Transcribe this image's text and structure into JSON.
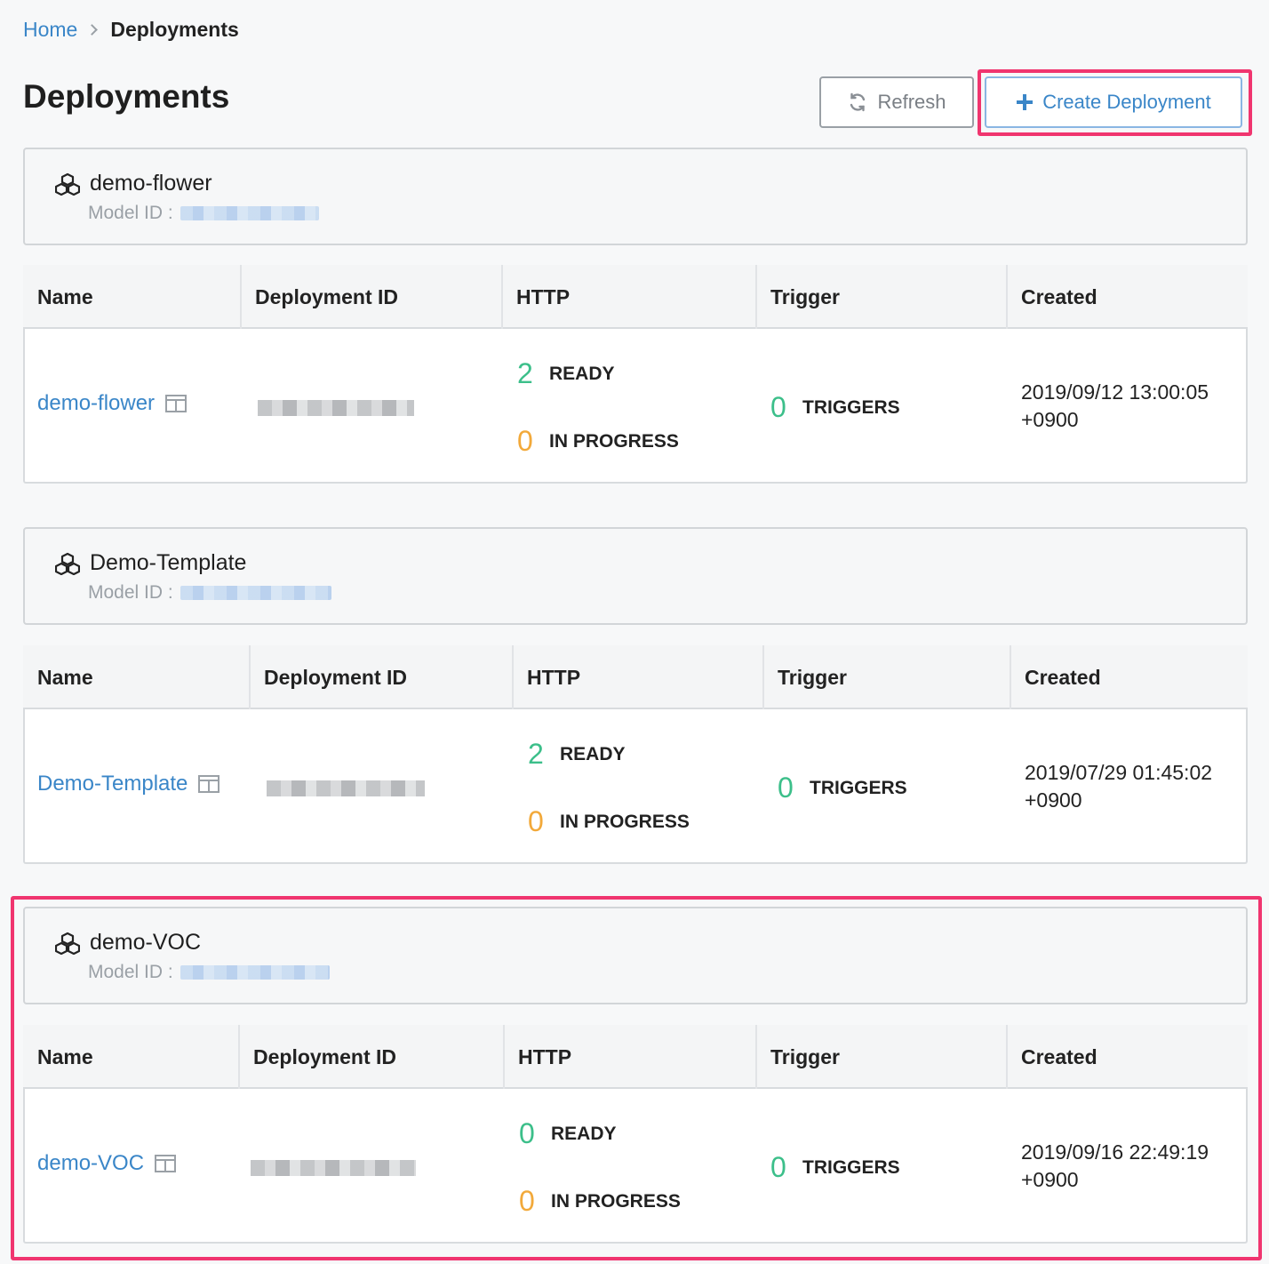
{
  "breadcrumb": {
    "home": "Home",
    "current": "Deployments"
  },
  "header": {
    "title": "Deployments",
    "refresh_label": "Refresh",
    "create_label": "Create Deployment"
  },
  "colors": {
    "accent": "#3a86c8",
    "ready": "#3cbf8a",
    "in_progress": "#f2a93a",
    "highlight": "#f0356f"
  },
  "table_headers": {
    "name": "Name",
    "deployment_id": "Deployment ID",
    "http": "HTTP",
    "trigger": "Trigger",
    "created": "Created"
  },
  "labels": {
    "model_id": "Model ID :",
    "ready": "READY",
    "in_progress": "IN PROGRESS",
    "triggers": "TRIGGERS"
  },
  "models": [
    {
      "name": "demo-flower",
      "deployment": {
        "name": "demo-flower",
        "ready": "2",
        "in_progress": "0",
        "triggers": "0",
        "created_line1": "2019/09/12 13:00:05",
        "created_line2": "+0900"
      }
    },
    {
      "name": "Demo-Template",
      "deployment": {
        "name": "Demo-Template",
        "ready": "2",
        "in_progress": "0",
        "triggers": "0",
        "created_line1": "2019/07/29 01:45:02",
        "created_line2": "+0900"
      }
    },
    {
      "name": "demo-VOC",
      "deployment": {
        "name": "demo-VOC",
        "ready": "0",
        "in_progress": "0",
        "triggers": "0",
        "created_line1": "2019/09/16 22:49:19",
        "created_line2": "+0900"
      }
    }
  ]
}
